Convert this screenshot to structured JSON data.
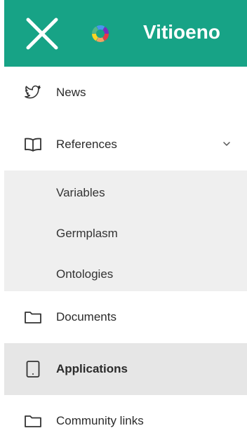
{
  "header": {
    "brand": "Vitioeno",
    "bg_color": "#17a386",
    "close_icon": "close-icon",
    "logo_icon": "colorful-ring-logo"
  },
  "menu": {
    "items": [
      {
        "label": "News",
        "icon": "twitter-icon"
      },
      {
        "label": "References",
        "icon": "book-icon",
        "expanded": true,
        "children": [
          "Variables",
          "Germplasm",
          "Ontologies"
        ]
      },
      {
        "label": "Documents",
        "icon": "folder-icon"
      },
      {
        "label": "Applications",
        "icon": "tablet-icon",
        "active": true
      },
      {
        "label": "Community links",
        "icon": "folder-icon"
      }
    ]
  }
}
